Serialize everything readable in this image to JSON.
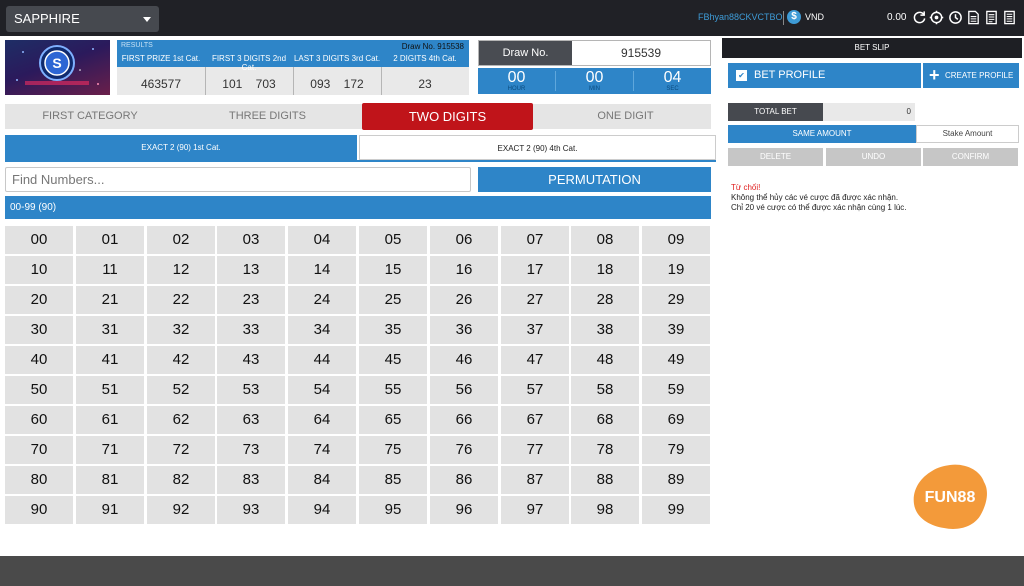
{
  "topbar": {
    "game_select": "SAPPHIRE",
    "username": "FBhyan88CKVCTBO",
    "currency_symbol": "$",
    "currency": "VND",
    "balance": "0.00",
    "icons": [
      "refresh-icon",
      "settings-icon",
      "history-icon",
      "document-icon",
      "receipt-icon",
      "list-icon"
    ]
  },
  "results": {
    "label": "RESULTS",
    "draw_label": "Draw No. 915538",
    "columns": [
      {
        "title": "FIRST PRIZE 1st Cat.",
        "value": "463577"
      },
      {
        "title": "FIRST 3 DIGITS 2nd Cat.",
        "value": "101    703"
      },
      {
        "title": "LAST 3 DIGITS 3rd Cat.",
        "value": "093    172"
      },
      {
        "title": "2 DIGITS 4th Cat.",
        "value": "23"
      }
    ]
  },
  "draw": {
    "label": "Draw No.",
    "value": "915539"
  },
  "countdown": [
    {
      "value": "00",
      "unit": "HOUR"
    },
    {
      "value": "00",
      "unit": "MIN"
    },
    {
      "value": "04",
      "unit": "SEC"
    }
  ],
  "category_tabs": [
    "FIRST CATEGORY",
    "THREE DIGITS",
    "TWO DIGITS",
    "ONE DIGIT"
  ],
  "active_category": "TWO DIGITS",
  "sub_tabs": [
    "EXACT 2 (90) 1st Cat.",
    "EXACT 2 (90) 4th Cat."
  ],
  "search": {
    "placeholder": "Find Numbers...",
    "value": ""
  },
  "permutation_label": "PERMUTATION",
  "range_label": "00-99 (90)",
  "numbers": [
    [
      "00",
      "01",
      "02",
      "03",
      "04",
      "05",
      "06",
      "07",
      "08",
      "09"
    ],
    [
      "10",
      "11",
      "12",
      "13",
      "14",
      "15",
      "16",
      "17",
      "18",
      "19"
    ],
    [
      "20",
      "21",
      "22",
      "23",
      "24",
      "25",
      "26",
      "27",
      "28",
      "29"
    ],
    [
      "30",
      "31",
      "32",
      "33",
      "34",
      "35",
      "36",
      "37",
      "38",
      "39"
    ],
    [
      "40",
      "41",
      "42",
      "43",
      "44",
      "45",
      "46",
      "47",
      "48",
      "49"
    ],
    [
      "50",
      "51",
      "52",
      "53",
      "54",
      "55",
      "56",
      "57",
      "58",
      "59"
    ],
    [
      "60",
      "61",
      "62",
      "63",
      "64",
      "65",
      "66",
      "67",
      "68",
      "69"
    ],
    [
      "70",
      "71",
      "72",
      "73",
      "74",
      "75",
      "76",
      "77",
      "78",
      "79"
    ],
    [
      "80",
      "81",
      "82",
      "83",
      "84",
      "85",
      "86",
      "87",
      "88",
      "89"
    ],
    [
      "90",
      "91",
      "92",
      "93",
      "94",
      "95",
      "96",
      "97",
      "98",
      "99"
    ]
  ],
  "bet_slip": {
    "title": "BET SLIP",
    "bet_profile": "BET PROFILE",
    "create_profile": "CREATE PROFILE",
    "total_bet_label": "TOTAL BET",
    "total_bet_value": "0",
    "same_amount": "SAME AMOUNT",
    "stake_amount": "Stake Amount",
    "actions": [
      "DELETE",
      "UNDO",
      "CONFIRM"
    ],
    "warning_title": "Từ chối!",
    "warning_line1": "Không thể hủy các vé cược đã được xác nhận.",
    "warning_line2": "Chỉ 20 vé cược có thể được xác nhận cùng 1 lúc."
  },
  "brand_logo": "FUN88",
  "colors": {
    "accent": "#2e85c8",
    "active_tab": "#c0141a",
    "topbar": "#202126",
    "brand": "#f39a3a"
  }
}
